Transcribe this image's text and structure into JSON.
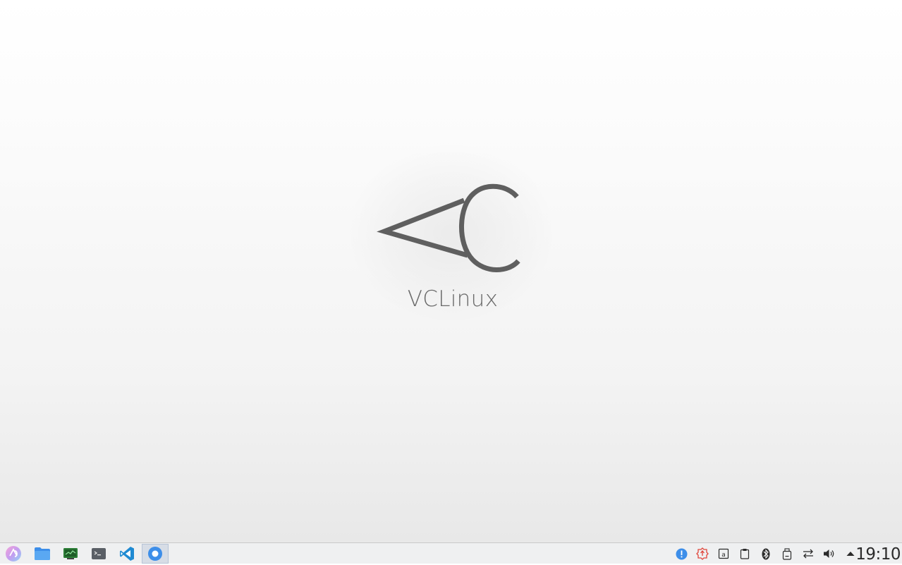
{
  "desktop": {
    "brand_name": "VCLinux"
  },
  "taskbar": {
    "launchers": [
      {
        "name": "app-launcher-icon"
      },
      {
        "name": "file-manager-icon"
      },
      {
        "name": "system-monitor-icon"
      },
      {
        "name": "terminal-icon"
      },
      {
        "name": "vscode-icon"
      },
      {
        "name": "active-app-icon",
        "active": true
      }
    ],
    "tray": [
      {
        "name": "info-notification-icon"
      },
      {
        "name": "update-alert-icon"
      },
      {
        "name": "keyboard-layout-icon"
      },
      {
        "name": "clipboard-icon"
      },
      {
        "name": "bluetooth-icon"
      },
      {
        "name": "removable-device-icon"
      },
      {
        "name": "network-icon"
      },
      {
        "name": "volume-icon"
      },
      {
        "name": "expand-tray-icon"
      }
    ],
    "clock": "19:10"
  },
  "colors": {
    "logo": "#5f5f5f",
    "taskbar_bg": "#eff0f1",
    "accent_blue": "#3d8ee9",
    "alert_red": "#e0453a"
  }
}
